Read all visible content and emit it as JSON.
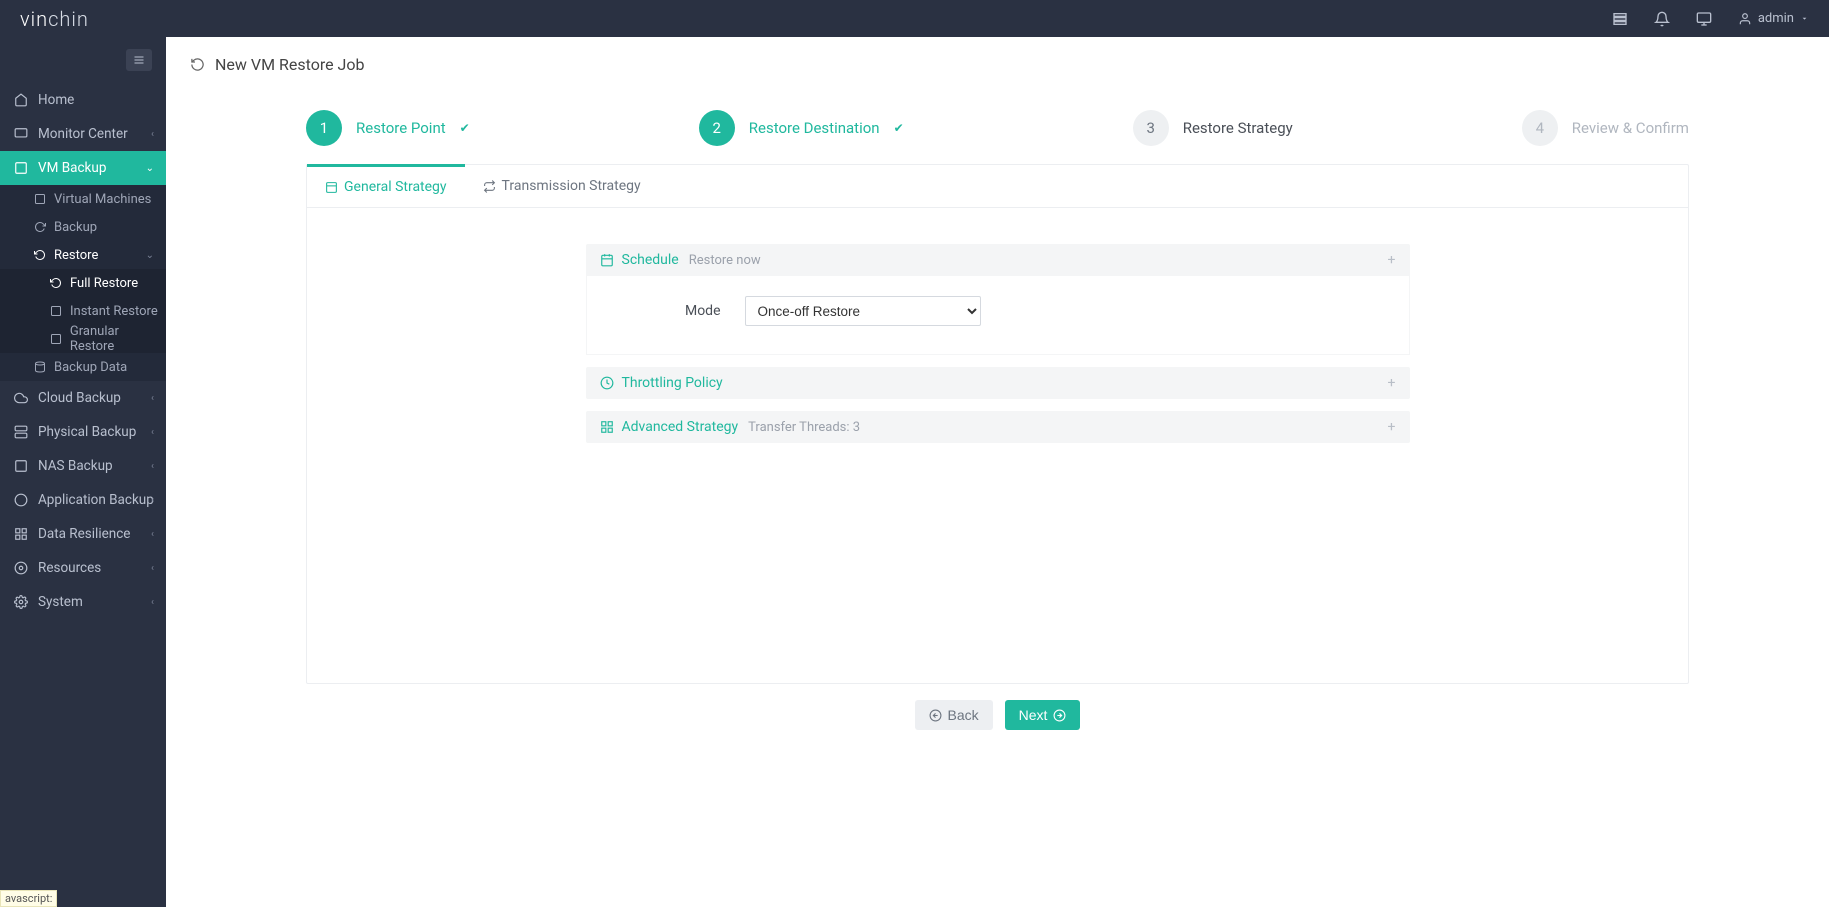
{
  "brand": {
    "part1": "vin",
    "part2": "chin"
  },
  "topbar": {
    "user_label": "admin"
  },
  "sidebar": {
    "items": [
      {
        "label": "Home"
      },
      {
        "label": "Monitor Center"
      },
      {
        "label": "VM Backup"
      },
      {
        "label": "Cloud Backup"
      },
      {
        "label": "Physical Backup"
      },
      {
        "label": "NAS Backup"
      },
      {
        "label": "Application Backup"
      },
      {
        "label": "Data Resilience"
      },
      {
        "label": "Resources"
      },
      {
        "label": "System"
      }
    ],
    "vm_backup_sub": [
      {
        "label": "Virtual Machines"
      },
      {
        "label": "Backup"
      },
      {
        "label": "Restore"
      },
      {
        "label": "Backup Data"
      }
    ],
    "restore_sub": [
      {
        "label": "Full Restore"
      },
      {
        "label": "Instant Restore"
      },
      {
        "label": "Granular Restore"
      }
    ]
  },
  "page": {
    "title": "New VM Restore Job"
  },
  "wizard": {
    "steps": [
      {
        "num": "1",
        "label": "Restore Point"
      },
      {
        "num": "2",
        "label": "Restore Destination"
      },
      {
        "num": "3",
        "label": "Restore Strategy"
      },
      {
        "num": "4",
        "label": "Review & Confirm"
      }
    ]
  },
  "tabs": {
    "general": "General Strategy",
    "transmission": "Transmission Strategy"
  },
  "panels": {
    "schedule": {
      "title": "Schedule",
      "sub": "Restore now",
      "mode_label": "Mode",
      "mode_value": "Once-off Restore"
    },
    "throttling": {
      "title": "Throttling Policy"
    },
    "advanced": {
      "title": "Advanced Strategy",
      "sub": "Transfer Threads: 3"
    }
  },
  "buttons": {
    "back": "Back",
    "next": "Next"
  },
  "status_link": "avascript:"
}
